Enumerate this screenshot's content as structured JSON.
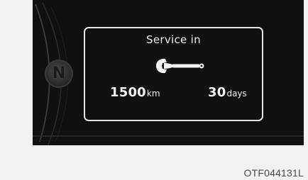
{
  "cluster": {
    "gear_indicator": "N",
    "service_reminder": {
      "title": "Service in",
      "icon": "wrench-icon",
      "distance_value": "1500",
      "distance_unit": "km",
      "days_value": "30",
      "days_unit": "days"
    }
  },
  "figure_code": "OTF044131L",
  "colors": {
    "page_background": "#f1f1f2",
    "display_background": "#101010",
    "panel_border": "#e4e4e4",
    "text": "#f2f2f2"
  }
}
